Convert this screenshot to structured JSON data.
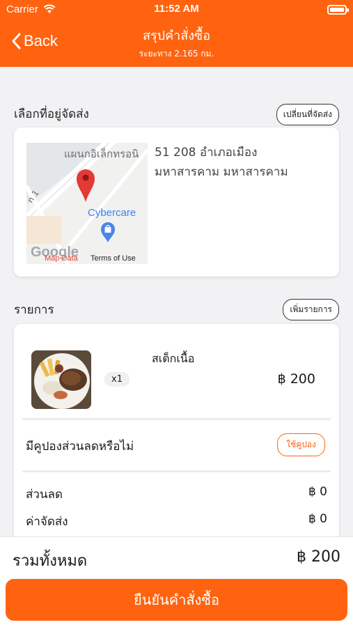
{
  "status_bar": {
    "carrier": "Carrier",
    "time": "11:52 AM"
  },
  "header": {
    "back_label": "Back",
    "title": "สรุปคำสั่งซื้อ",
    "subtitle": "ระยะทาง 2.165 กม.",
    "color": "#ff6310"
  },
  "delivery": {
    "section_label": "เลือกที่อยู่จัดส่ง",
    "change_label": "เปลี่ยนที่จัดส่ง",
    "address_line1": "51 208 อำเภอเมือง",
    "address_line2": "มหาสารคาม มหาสารคาม",
    "map": {
      "place_label": "แผนกอิเล็กทรอนิ",
      "poi_label": "Cybercare",
      "road_label": "n 1",
      "google_label": "Google",
      "map_data_label": "Map Data",
      "terms_label": "Terms of Use"
    }
  },
  "items_section": {
    "section_label": "รายการ",
    "add_label": "เพิ่มรายการ",
    "items": [
      {
        "name": "สเต็กเนื้อ",
        "qty": "x1",
        "price": "฿ 200"
      }
    ],
    "coupon_question": "มีคูปองส่วนลดหรือไม่",
    "coupon_button": "ใช้คูปอง",
    "discount_label": "ส่วนลด",
    "discount_value": "฿ 0",
    "delivery_fee_label": "ค่าจัดส่ง",
    "delivery_fee_value": "฿ 0"
  },
  "footer": {
    "total_label": "รวมทั้งหมด",
    "total_value": "฿ 200",
    "confirm_label": "ยืนยันคำสั่งซื้อ"
  },
  "icons": [
    "wifi-icon",
    "battery-icon",
    "chevron-left-icon",
    "map-pin-icon",
    "shopping-bag-icon"
  ]
}
